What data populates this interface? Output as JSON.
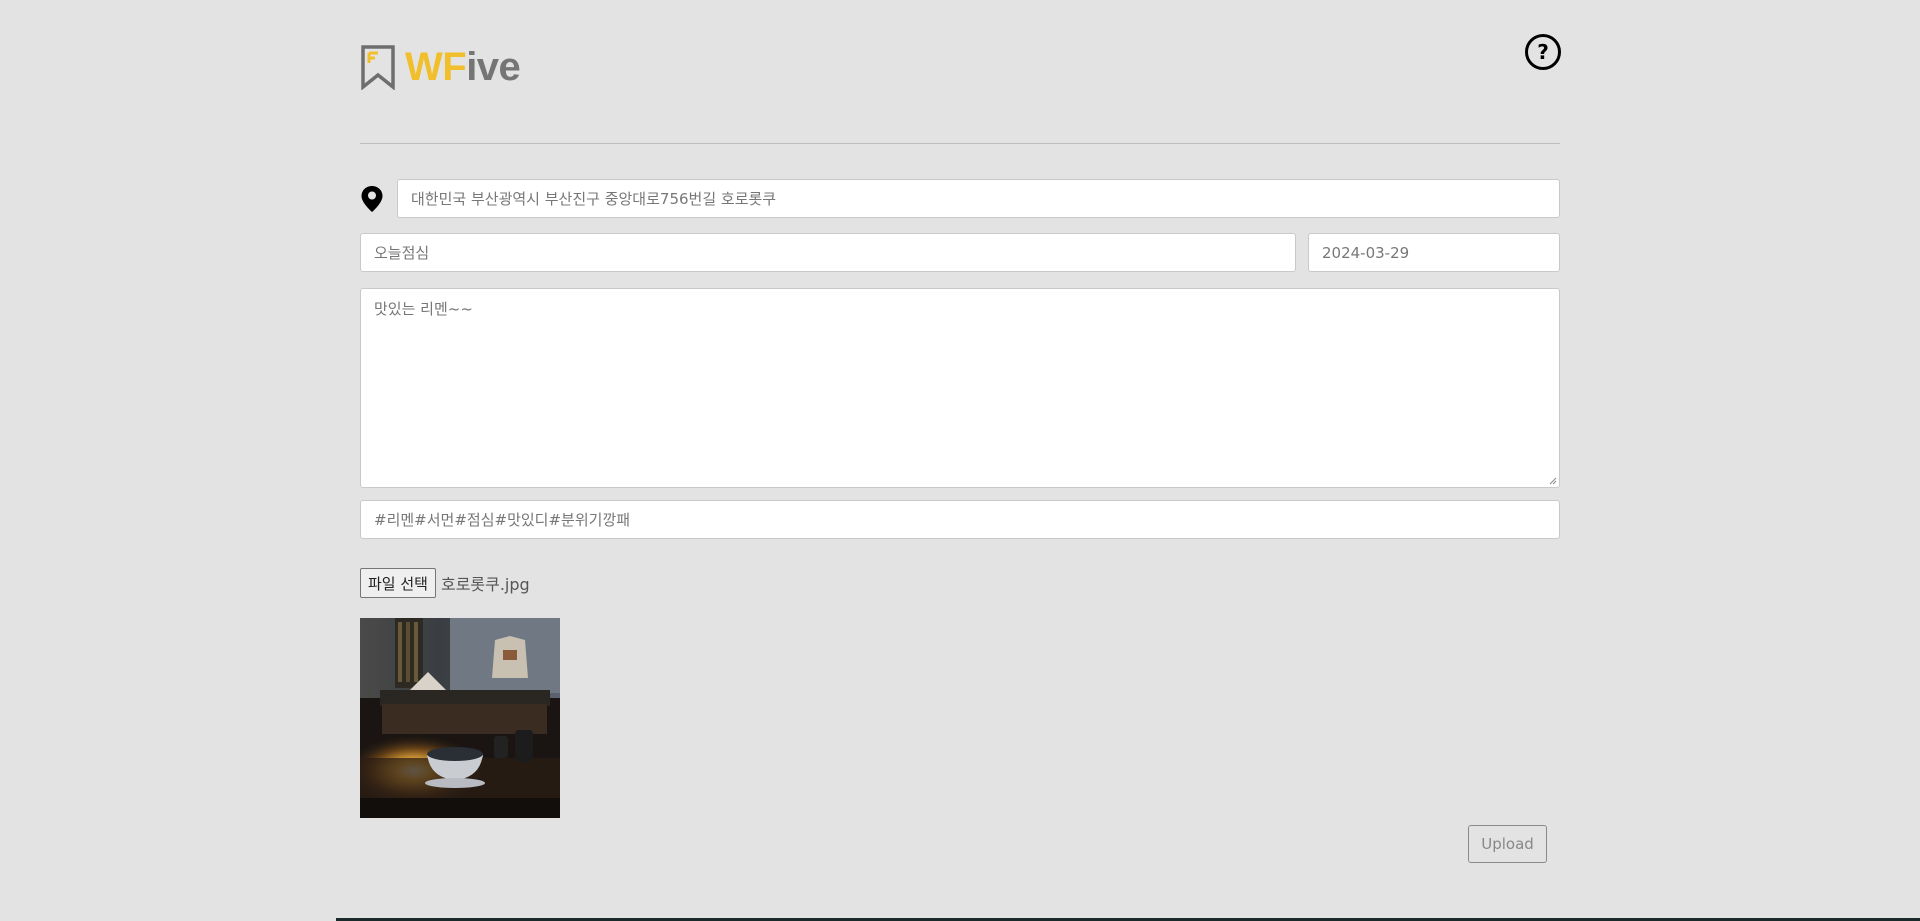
{
  "header": {
    "logo_accent": "WF",
    "logo_rest": "ive",
    "help_label": "?"
  },
  "form": {
    "location": "대한민국 부산광역시 부산진구 중앙대로756번길 호로롯쿠",
    "title": "오늘점심",
    "date": "2024-03-29",
    "content": "맛있는 리멘~~",
    "tags": "#리멘#서먼#점심#맛있디#분위기깡패"
  },
  "file": {
    "button_label": "파일 선택",
    "file_name": "호로롯쿠.jpg"
  },
  "actions": {
    "upload_label": "Upload"
  },
  "colors": {
    "background": "#e3e3e3",
    "brand_yellow": "#f1bf2b",
    "brand_gray": "#757575"
  },
  "icons": {
    "logo": "bookmark-logo-icon",
    "help": "question-circle-icon",
    "location": "map-pin-icon"
  }
}
